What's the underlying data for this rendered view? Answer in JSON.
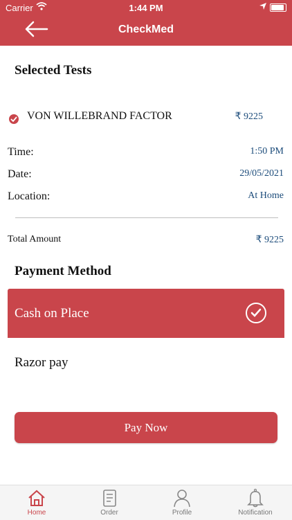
{
  "status": {
    "carrier": "Carrier",
    "time": "1:44 PM"
  },
  "header": {
    "title": "CheckMed"
  },
  "selected_tests": {
    "heading": "Selected Tests",
    "items": [
      {
        "name": "VON WILLEBRAND FACTOR",
        "price": "₹ 9225"
      }
    ]
  },
  "details": {
    "time_label": "Time:",
    "time_value": "1:50 PM",
    "date_label": "Date:",
    "date_value": "29/05/2021",
    "location_label": "Location:",
    "location_value": "At Home"
  },
  "total": {
    "label": "Total Amount",
    "value": "₹ 9225"
  },
  "payment": {
    "heading": "Payment Method",
    "options": [
      {
        "label": "Cash on Place",
        "selected": true
      },
      {
        "label": "Razor pay",
        "selected": false
      }
    ]
  },
  "pay_button": "Pay Now",
  "tabs": [
    {
      "label": "Home",
      "icon": "home-icon",
      "active": true
    },
    {
      "label": "Order",
      "icon": "order-icon",
      "active": false
    },
    {
      "label": "Profile",
      "icon": "profile-icon",
      "active": false
    },
    {
      "label": "Notification",
      "icon": "bell-icon",
      "active": false
    }
  ],
  "colors": {
    "accent": "#c9454b",
    "value_text": "#1b4b7a"
  }
}
